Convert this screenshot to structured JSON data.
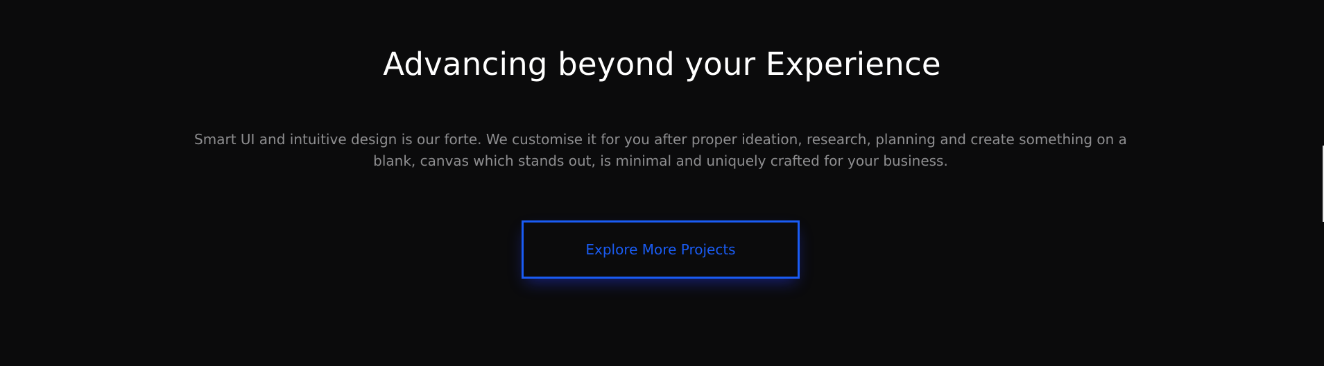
{
  "section": {
    "title": "Advancing beyond your Experience",
    "description": "Smart UI and intuitive design is our forte. We customise it for you after proper ideation, research, planning and create something on a blank, canvas which stands out, is minimal and uniquely crafted for your business.",
    "cta_label": "Explore More Projects"
  },
  "colors": {
    "background": "#0b0b0c",
    "title": "#ffffff",
    "body_text": "#8e8e90",
    "accent": "#1a5cf4"
  }
}
